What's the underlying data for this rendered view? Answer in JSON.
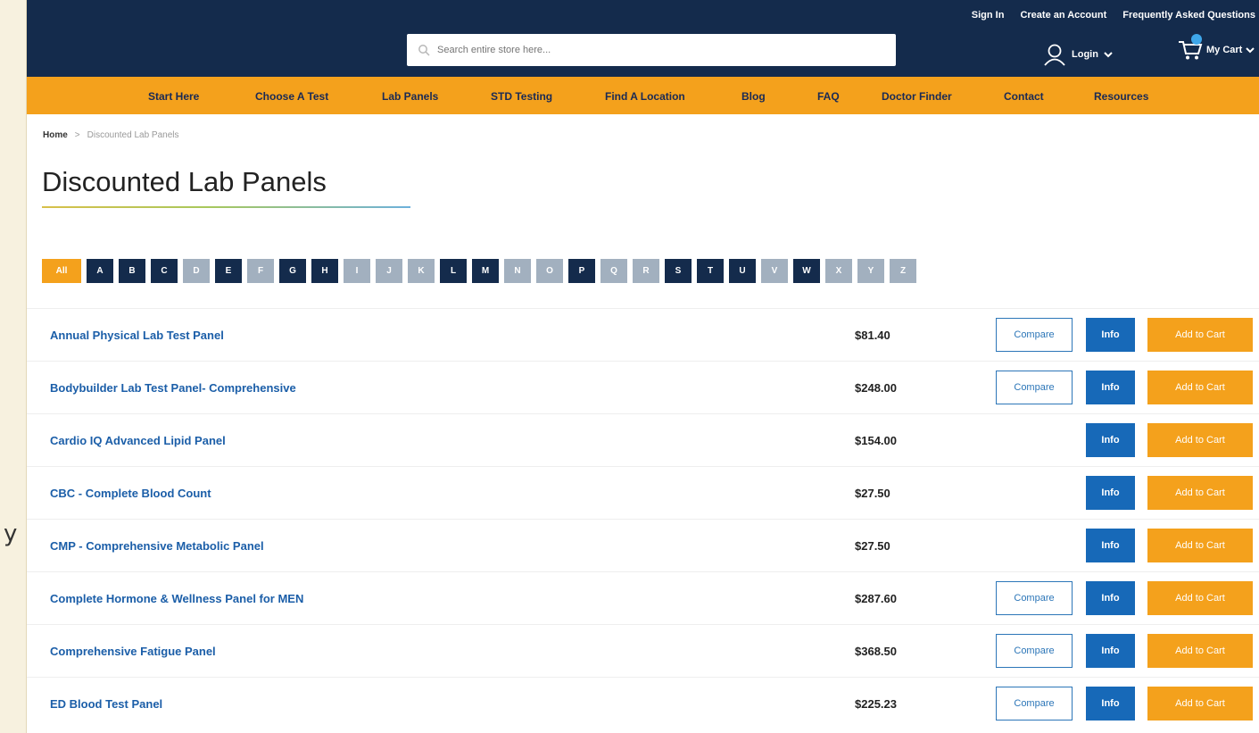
{
  "header": {
    "top_links": [
      "Sign In",
      "Create an Account",
      "Frequently Asked Questions"
    ],
    "search_placeholder": "Search entire store here...",
    "login_label": "Login",
    "cart_label": "My Cart"
  },
  "nav": {
    "items": [
      "Start Here",
      "Choose A Test",
      "Lab Panels",
      "STD Testing",
      "Find A Location",
      "Blog",
      "FAQ",
      "Doctor Finder",
      "Contact",
      "Resources"
    ]
  },
  "breadcrumb": {
    "home": "Home",
    "separator": ">",
    "current": "Discounted Lab Panels"
  },
  "page": {
    "title": "Discounted Lab Panels"
  },
  "alphabet": {
    "all_label": "All",
    "letters": [
      {
        "letter": "A",
        "enabled": true
      },
      {
        "letter": "B",
        "enabled": true
      },
      {
        "letter": "C",
        "enabled": true
      },
      {
        "letter": "D",
        "enabled": false
      },
      {
        "letter": "E",
        "enabled": true
      },
      {
        "letter": "F",
        "enabled": false
      },
      {
        "letter": "G",
        "enabled": true
      },
      {
        "letter": "H",
        "enabled": true
      },
      {
        "letter": "I",
        "enabled": false
      },
      {
        "letter": "J",
        "enabled": false
      },
      {
        "letter": "K",
        "enabled": false
      },
      {
        "letter": "L",
        "enabled": true
      },
      {
        "letter": "M",
        "enabled": true
      },
      {
        "letter": "N",
        "enabled": false
      },
      {
        "letter": "O",
        "enabled": false
      },
      {
        "letter": "P",
        "enabled": true
      },
      {
        "letter": "Q",
        "enabled": false
      },
      {
        "letter": "R",
        "enabled": false
      },
      {
        "letter": "S",
        "enabled": true
      },
      {
        "letter": "T",
        "enabled": true
      },
      {
        "letter": "U",
        "enabled": true
      },
      {
        "letter": "V",
        "enabled": false
      },
      {
        "letter": "W",
        "enabled": true
      },
      {
        "letter": "X",
        "enabled": false
      },
      {
        "letter": "Y",
        "enabled": false
      },
      {
        "letter": "Z",
        "enabled": false
      }
    ]
  },
  "buttons": {
    "compare": "Compare",
    "info": "Info",
    "add_to_cart": "Add to Cart"
  },
  "products": [
    {
      "name": "Annual Physical Lab Test Panel",
      "price": "$81.40",
      "has_compare": true
    },
    {
      "name": "Bodybuilder Lab Test Panel- Comprehensive",
      "price": "$248.00",
      "has_compare": true
    },
    {
      "name": "Cardio IQ Advanced Lipid Panel",
      "price": "$154.00",
      "has_compare": false
    },
    {
      "name": "CBC - Complete Blood Count",
      "price": "$27.50",
      "has_compare": false
    },
    {
      "name": "CMP - Comprehensive Metabolic Panel",
      "price": "$27.50",
      "has_compare": false
    },
    {
      "name": "Complete Hormone & Wellness Panel for MEN",
      "price": "$287.60",
      "has_compare": true
    },
    {
      "name": "Comprehensive Fatigue Panel",
      "price": "$368.50",
      "has_compare": true
    },
    {
      "name": "ED Blood Test Panel",
      "price": "$225.23",
      "has_compare": true
    }
  ],
  "colors": {
    "header_navy": "#142b4c",
    "nav_orange": "#f4a11c",
    "link_blue": "#1b5ea8",
    "info_blue": "#1769b8",
    "letter_disabled": "#a2b0bf"
  },
  "side_fragment": {
    "text": "y"
  }
}
